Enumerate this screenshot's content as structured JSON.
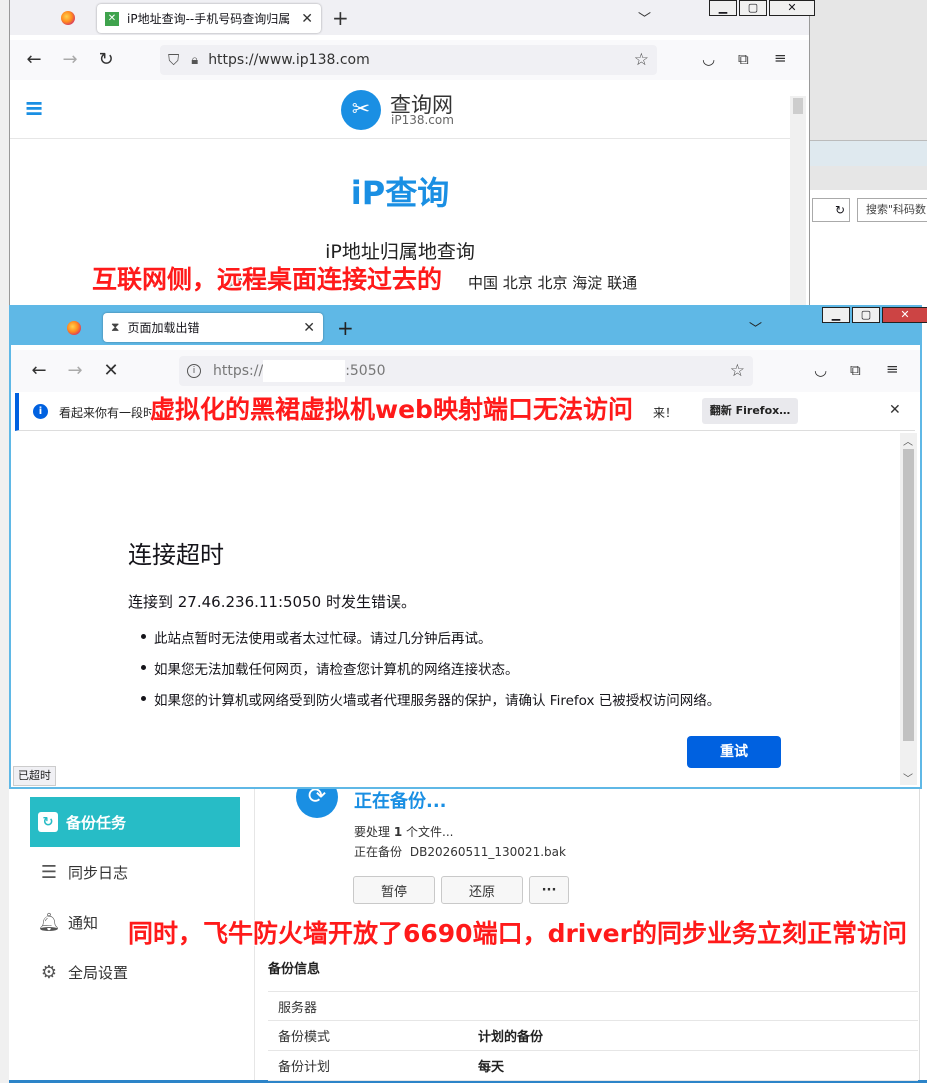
{
  "back_window": {
    "tab_title": "iP地址查询--手机号码查询归属",
    "url": "https://www.ip138.com",
    "brand_cn": "查询网",
    "brand_en": "iP138.com",
    "heading": "iP查询",
    "subheading": "iP地址归属地查询",
    "result_partial": "中国 北京 北京 海淀 联通",
    "result_prefix": "地"
  },
  "right_edge": {
    "search_placeholder": "搜索\"科码数"
  },
  "front_window": {
    "tab_title": "页面加载出错",
    "url_prefix": "https://",
    "url_suffix": ":5050",
    "notice_text": "看起来你有一段时",
    "notice_tail": "来！",
    "notice_button": "翻新 Firefox…",
    "error_title": "连接超时",
    "error_desc": "连接到 27.46.236.11:5050 时发生错误。",
    "bullets": [
      "此站点暂时无法使用或者太过忙碌。请过几分钟后再试。",
      "如果您无法加载任何网页，请检查您计算机的网络连接状态。",
      "如果您的计算机或网络受到防火墙或者代理服务器的保护，请确认 Firefox 已被授权访问网络。"
    ],
    "retry_button": "重试",
    "status_text": "已超时"
  },
  "backup_app": {
    "sidebar": [
      {
        "label": "备份任务",
        "icon": "backup-task-icon",
        "active": true
      },
      {
        "label": "同步日志",
        "icon": "list-icon",
        "active": false
      },
      {
        "label": "通知",
        "icon": "bell-icon",
        "active": false
      },
      {
        "label": "全局设置",
        "icon": "gear-icon",
        "active": false
      }
    ],
    "status_title": "正在备份...",
    "pending_prefix": "要处理",
    "pending_count": "1",
    "pending_suffix": "个文件...",
    "current_file_prefix": "正在备份",
    "current_file": "DB20260511_130021.bak",
    "pause_button": "暂停",
    "restore_button": "还原",
    "more_button": "···",
    "info_heading": "备份信息",
    "info_rows": [
      {
        "key": "服务器",
        "value": ""
      },
      {
        "key": "备份模式",
        "value": "计划的备份"
      },
      {
        "key": "备份计划",
        "value": "每天"
      }
    ]
  },
  "annotations": {
    "top": "互联网侧，远程桌面连接过去的",
    "middle": "虚拟化的黑裙虚拟机web映射端口无法访问",
    "bottom": "同时，飞牛防火墙开放了6690端口，driver的同步业务立刻正常访问"
  },
  "colors": {
    "accent_blue": "#0061e0",
    "brand_blue": "#1a8fe3",
    "teal_active": "#27bcc6",
    "annotation_red": "#ff1a1a",
    "titlebar_blue": "#5fb8e6"
  }
}
